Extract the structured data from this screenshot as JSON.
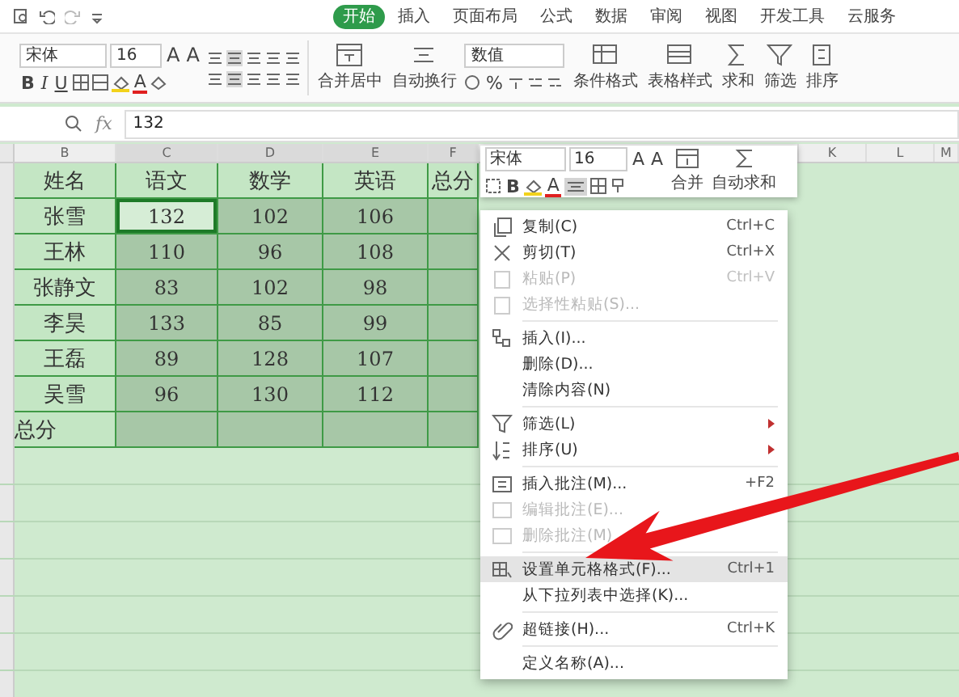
{
  "ribbon": {
    "tabs": [
      {
        "label": "开始",
        "selected": true
      },
      {
        "label": "插入",
        "selected": false
      },
      {
        "label": "页面布局",
        "selected": false
      },
      {
        "label": "公式",
        "selected": false
      },
      {
        "label": "数据",
        "selected": false
      },
      {
        "label": "审阅",
        "selected": false
      },
      {
        "label": "视图",
        "selected": false
      },
      {
        "label": "开发工具",
        "selected": false
      },
      {
        "label": "云服务",
        "selected": false
      }
    ],
    "font": {
      "name": "宋体",
      "size": "16"
    },
    "size_buttons": [
      "A",
      "A"
    ],
    "style_buttons": [
      "B",
      "I",
      "U"
    ],
    "color_button": "A",
    "merge_label": "合并居中",
    "wrap_label": "自动换行",
    "number_format": "数值",
    "percent": "%",
    "tools": [
      {
        "label": "条件格式"
      },
      {
        "label": "表格样式"
      },
      {
        "label": "求和"
      },
      {
        "label": "筛选"
      },
      {
        "label": "排序"
      }
    ]
  },
  "formula_bar": {
    "label": "fx",
    "value": "132"
  },
  "column_headers": [
    "B",
    "C",
    "D",
    "E",
    "F",
    "K",
    "L",
    "M"
  ],
  "table": {
    "rows": [
      {
        "kind": "header",
        "cells": [
          {
            "text": "姓名",
            "selected": false,
            "active": false
          },
          {
            "text": "语文",
            "selected": false,
            "active": false
          },
          {
            "text": "数学",
            "selected": false,
            "active": false
          },
          {
            "text": "英语",
            "selected": false,
            "active": false
          },
          {
            "text": "总分",
            "selected": false,
            "active": false
          }
        ]
      },
      {
        "kind": "data",
        "cells": [
          {
            "text": "张雪",
            "selected": false,
            "active": false
          },
          {
            "text": "132",
            "selected": true,
            "active": true
          },
          {
            "text": "102",
            "selected": true,
            "active": false
          },
          {
            "text": "106",
            "selected": true,
            "active": false
          },
          {
            "selected": true,
            "active": false
          }
        ]
      },
      {
        "kind": "data",
        "cells": [
          {
            "text": "王林",
            "selected": false,
            "active": false
          },
          {
            "text": "110",
            "selected": true,
            "active": false
          },
          {
            "text": "96",
            "selected": true,
            "active": false
          },
          {
            "text": "108",
            "selected": true,
            "active": false
          },
          {
            "selected": true,
            "active": false
          }
        ]
      },
      {
        "kind": "data",
        "cells": [
          {
            "text": "张静文",
            "selected": false,
            "active": false
          },
          {
            "text": "83",
            "selected": true,
            "active": false
          },
          {
            "text": "102",
            "selected": true,
            "active": false
          },
          {
            "text": "98",
            "selected": true,
            "active": false
          },
          {
            "selected": true,
            "active": false
          }
        ]
      },
      {
        "kind": "data",
        "cells": [
          {
            "text": "李昊",
            "selected": false,
            "active": false
          },
          {
            "text": "133",
            "selected": true,
            "active": false
          },
          {
            "text": "85",
            "selected": true,
            "active": false
          },
          {
            "text": "99",
            "selected": true,
            "active": false
          },
          {
            "selected": true,
            "active": false
          }
        ]
      },
      {
        "kind": "data",
        "cells": [
          {
            "text": "王磊",
            "selected": false,
            "active": false
          },
          {
            "text": "89",
            "selected": true,
            "active": false
          },
          {
            "text": "128",
            "selected": true,
            "active": false
          },
          {
            "text": "107",
            "selected": true,
            "active": false
          },
          {
            "selected": true,
            "active": false
          }
        ]
      },
      {
        "kind": "data",
        "cells": [
          {
            "text": "吴雪",
            "selected": false,
            "active": false
          },
          {
            "text": "96",
            "selected": true,
            "active": false
          },
          {
            "text": "130",
            "selected": true,
            "active": false
          },
          {
            "text": "112",
            "selected": true,
            "active": false
          },
          {
            "selected": true,
            "active": false
          }
        ]
      },
      {
        "kind": "total",
        "cells": [
          {
            "text": "总分",
            "selected": false,
            "active": false
          },
          {
            "selected": true,
            "active": false
          },
          {
            "selected": true,
            "active": false
          },
          {
            "selected": true,
            "active": false
          },
          {
            "selected": true,
            "active": false
          }
        ]
      }
    ]
  },
  "mini_toolbar": {
    "font": "宋体",
    "size": "16",
    "size_buttons": [
      "A",
      "A"
    ],
    "bold": "B",
    "color_button": "A",
    "merge_label": "合并",
    "sum_label": "自动求和"
  },
  "context_menu": [
    {
      "kind": "item",
      "label": "复制(C)",
      "shortcut": "Ctrl+C",
      "disabled": false,
      "selected": false,
      "submenu": false
    },
    {
      "kind": "item",
      "label": "剪切(T)",
      "shortcut": "Ctrl+X",
      "disabled": false,
      "selected": false,
      "submenu": false
    },
    {
      "kind": "item",
      "label": "粘贴(P)",
      "shortcut": "Ctrl+V",
      "disabled": true,
      "selected": false,
      "submenu": false
    },
    {
      "kind": "item",
      "label": "选择性粘贴(S)...",
      "disabled": true,
      "selected": false,
      "submenu": false
    },
    {
      "kind": "separator"
    },
    {
      "kind": "item",
      "label": "插入(I)...",
      "disabled": false,
      "selected": false,
      "submenu": false
    },
    {
      "kind": "item",
      "label": "删除(D)...",
      "disabled": false,
      "selected": false,
      "submenu": false
    },
    {
      "kind": "item",
      "label": "清除内容(N)",
      "disabled": false,
      "selected": false,
      "submenu": false
    },
    {
      "kind": "separator"
    },
    {
      "kind": "item",
      "label": "筛选(L)",
      "disabled": false,
      "selected": false,
      "submenu": true
    },
    {
      "kind": "item",
      "label": "排序(U)",
      "disabled": false,
      "selected": false,
      "submenu": true
    },
    {
      "kind": "separator"
    },
    {
      "kind": "item",
      "label": "插入批注(M)...",
      "shortcut": "+F2",
      "disabled": false,
      "selected": false,
      "submenu": false
    },
    {
      "kind": "item",
      "label": "编辑批注(E)...",
      "disabled": true,
      "selected": false,
      "submenu": false
    },
    {
      "kind": "item",
      "label": "删除批注(M)",
      "disabled": true,
      "selected": false,
      "submenu": false
    },
    {
      "kind": "separator"
    },
    {
      "kind": "item",
      "label": "设置单元格格式(F)...",
      "shortcut": "Ctrl+1",
      "disabled": false,
      "selected": true,
      "submenu": false
    },
    {
      "kind": "item",
      "label": "从下拉列表中选择(K)...",
      "disabled": false,
      "selected": false,
      "submenu": false
    },
    {
      "kind": "separator"
    },
    {
      "kind": "item",
      "label": "超链接(H)...",
      "shortcut": "Ctrl+K",
      "disabled": false,
      "selected": false,
      "submenu": false
    },
    {
      "kind": "separator"
    },
    {
      "kind": "item",
      "label": "定义名称(A)...",
      "disabled": false,
      "selected": false,
      "submenu": false
    }
  ]
}
